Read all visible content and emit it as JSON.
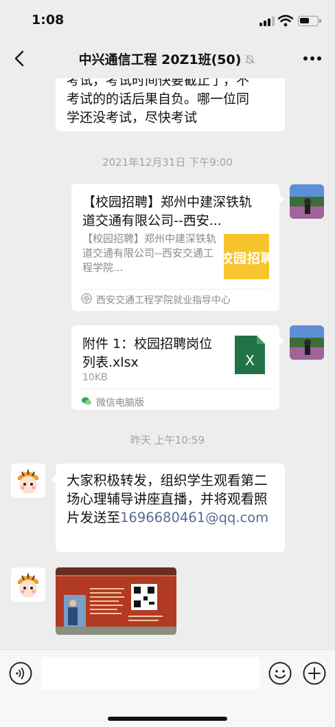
{
  "status": {
    "time": "1:08",
    "battery_level": 0.55
  },
  "header": {
    "title": "中兴通信工程 20Z1班(50)"
  },
  "messages": {
    "m1": {
      "lines": [
        "考试，考试时间快要截止了，不",
        "考试的的话后果自负。哪一位同",
        "学还没考试，尽快考试"
      ]
    },
    "ts1": "2021年12月31日 下午9:00",
    "card": {
      "title": "【校园招聘】郑州中建深铁轨道交通有限公司--西安...",
      "desc": "【校园招聘】郑州中建深铁轨道交通有限公司--西安交通工程学院...",
      "thumb_text": "校园招聘",
      "source": "西安交通工程学院就业指导中心"
    },
    "file": {
      "name": "附件 1：校园招聘岗位列表.xlsx",
      "size": "10KB",
      "source": "微信电脑版",
      "icon_letter": "X"
    },
    "ts2": "昨天 上午10:59",
    "m2": {
      "text": "大家积极转发，组织学生观看第二场心理辅导讲座直播，并将观看照片发送至",
      "link": "1696680461@qq.com"
    }
  },
  "icons": {
    "back": "chevron-left-icon",
    "mute": "bell-off-icon",
    "more": "more-horizontal-icon",
    "voice": "voice-icon",
    "emoji": "emoji-icon",
    "plus": "plus-icon"
  },
  "colors": {
    "background": "#ededed",
    "bubble": "#ffffff",
    "timestamp": "#a3a3a3",
    "link": "#576b95",
    "excel": "#217346"
  }
}
